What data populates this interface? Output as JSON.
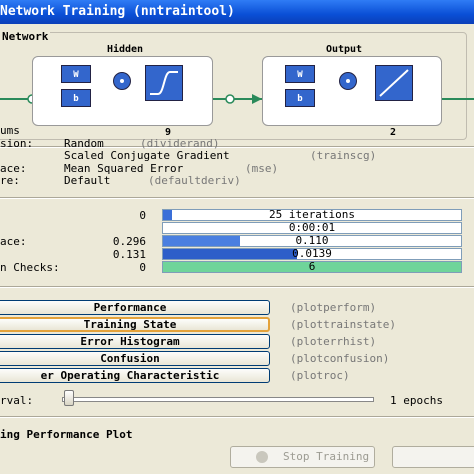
{
  "window": {
    "title": "Network Training (nntraintool)"
  },
  "network": {
    "section_label": "Network",
    "hidden": {
      "title": "Hidden",
      "w_label": "W",
      "b_label": "b",
      "count": "9"
    },
    "output": {
      "title": "Output",
      "w_label": "W",
      "b_label": "b",
      "count": "2"
    }
  },
  "algorithms": {
    "section_label": "ums",
    "rows": [
      {
        "label": "sion:",
        "value": "Random",
        "code": "(dividerand)"
      },
      {
        "label": "",
        "value": "Scaled Conjugate Gradient",
        "code": "(trainscg)"
      },
      {
        "label": "ace:",
        "value": "Mean Squared Error",
        "code": "(mse)"
      },
      {
        "label": "re:",
        "value": "Default",
        "code": "(defaultderiv)"
      }
    ]
  },
  "progress": {
    "rows": [
      {
        "label": "",
        "start": "0",
        "text": "25 iterations",
        "fill": 0.03,
        "color": "#3a6fd8"
      },
      {
        "label": "",
        "start": "",
        "text": "0:00:01",
        "fill": 0.0,
        "color": "#3a6fd8"
      },
      {
        "label": "ace:",
        "start": "0.296",
        "text": "0.110",
        "fill": 0.26,
        "color": "#4a7fe0"
      },
      {
        "label": "",
        "start": "0.131",
        "text": "0.0139",
        "fill": 0.45,
        "color": "#2d5ec9"
      },
      {
        "label": "n Checks:",
        "start": "0",
        "text": "6",
        "fill": 1.0,
        "color": "#6fd49a"
      }
    ]
  },
  "plots": {
    "buttons": [
      {
        "label": "Performance",
        "code": "(plotperform)"
      },
      {
        "label": "Training State",
        "code": "(plottrainstate)"
      },
      {
        "label": "Error Histogram",
        "code": "(ploterrhist)"
      },
      {
        "label": "Confusion",
        "code": "(plotconfusion)"
      },
      {
        "label": "er Operating Characteristic",
        "code": "(plotroc)"
      }
    ],
    "interval_label": "rval:",
    "interval_value": "1 epochs"
  },
  "footer": {
    "status": "ing Performance Plot",
    "stop_label": "Stop Training"
  },
  "colors": {
    "titlebar": "#0a4fd6",
    "block": "#3366cc",
    "validation": "#6fd49a"
  }
}
